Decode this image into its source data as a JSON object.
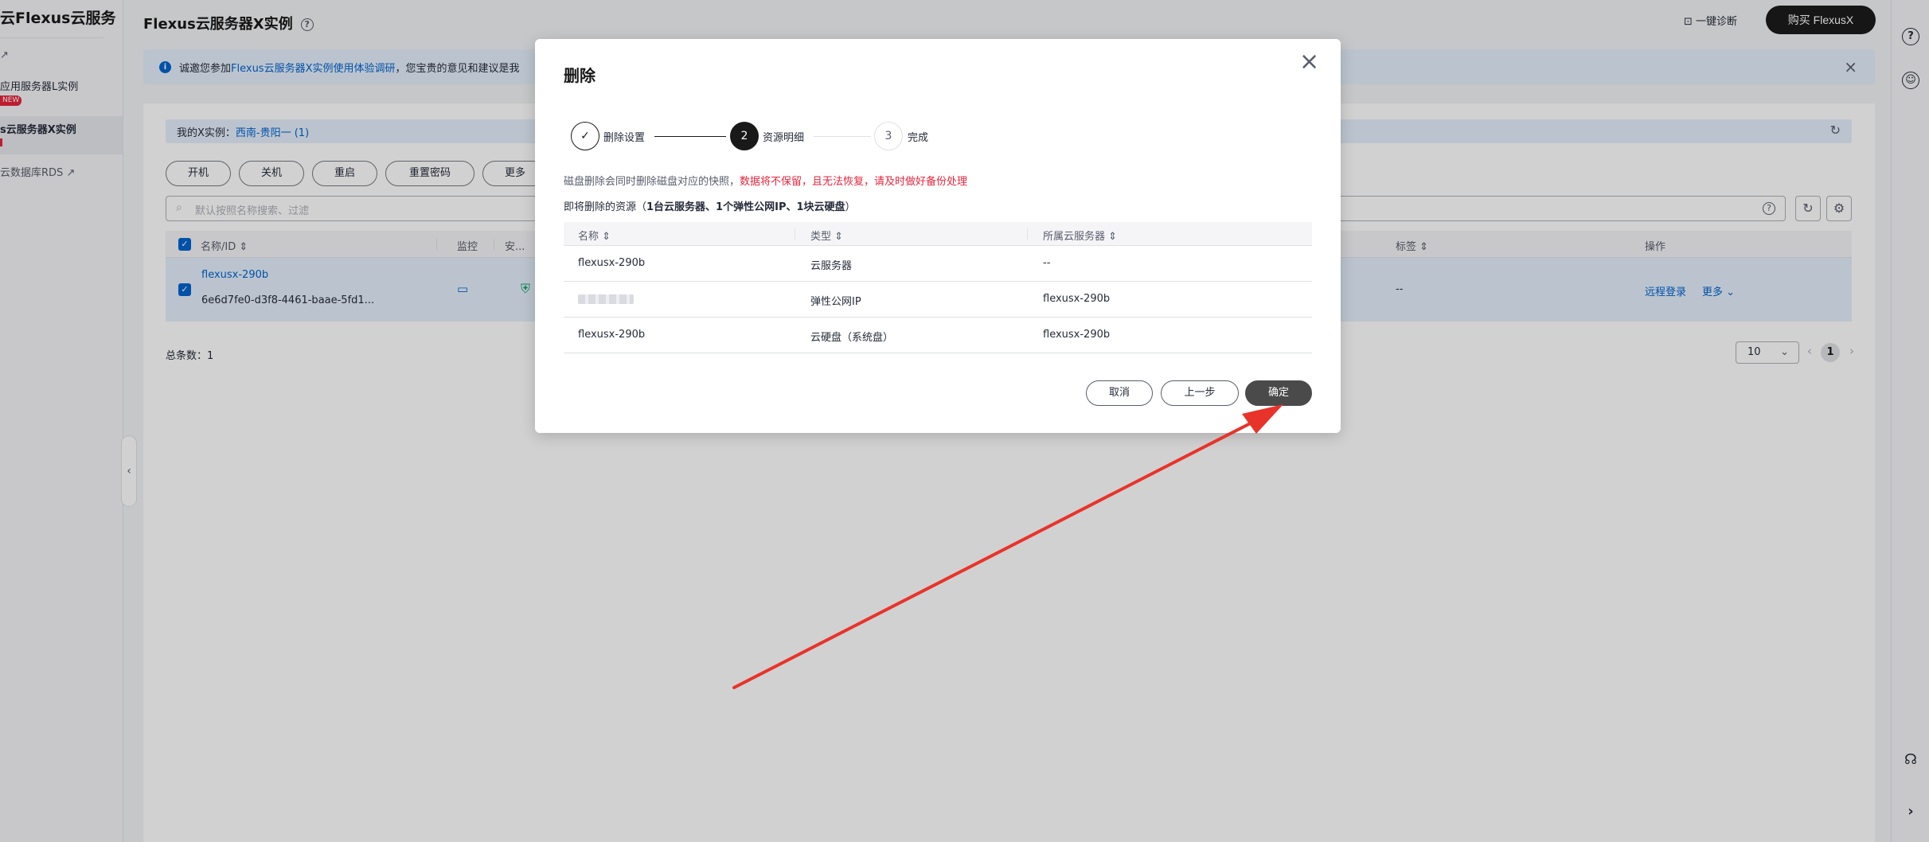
{
  "sidebar": {
    "title": "云Flexus云服务",
    "ext_icon": "↗",
    "item1": "应用服务器L实例",
    "new_badge": "NEW",
    "item2": "s云服务器X实例",
    "item3": "云数据库RDS"
  },
  "header": {
    "title": "Flexus云服务器X实例",
    "diagnose": "一键诊断",
    "buy": "购买 FlexusX"
  },
  "notice": {
    "prefix": "诚邀您参加",
    "link": "Flexus云服务器X实例使用体验调研",
    "suffix": "，您宝贵的意见和建议是我"
  },
  "region": {
    "label": "我的X实例：",
    "value": "西南-贵阳一 (1)"
  },
  "actions": [
    "开机",
    "关机",
    "重启",
    "重置密码",
    "更多"
  ],
  "search": {
    "placeholder": "默认按照名称搜索、过滤"
  },
  "table": {
    "headers": {
      "name": "名称/ID",
      "monitor": "监控",
      "security": "安...",
      "tags": "标签",
      "ops": "操作"
    },
    "row": {
      "name": "flexusx-290b",
      "id": "6e6d7fe0-d3f8-4461-baae-5fd1...",
      "tags": "--",
      "remote": "远程登录",
      "more": "更多"
    }
  },
  "footer": {
    "total": "总条数：1",
    "page_size": "10",
    "page": "1"
  },
  "modal": {
    "title": "删除",
    "steps": [
      {
        "label": "删除设置",
        "num": "✓"
      },
      {
        "label": "资源明细",
        "num": "2"
      },
      {
        "label": "完成",
        "num": "3"
      }
    ],
    "warning_prefix": "磁盘删除会同时删除磁盘对应的快照，",
    "warning_red": "数据将不保留，且无法恢复，请及时做好备份处理",
    "resource_prefix": "即将删除的资源（",
    "resource_bold": "1台云服务器、1个弹性公网IP、1块云硬盘",
    "resource_suffix": "）",
    "columns": {
      "name": "名称",
      "type": "类型",
      "server": "所属云服务器"
    },
    "rows": [
      {
        "name": "flexusx-290b",
        "type": "云服务器",
        "server": "--"
      },
      {
        "name": "",
        "type": "弹性公网IP",
        "server": "flexusx-290b"
      },
      {
        "name": "flexusx-290b",
        "type": "云硬盘（系统盘）",
        "server": "flexusx-290b"
      }
    ],
    "buttons": {
      "cancel": "取消",
      "prev": "上一步",
      "confirm": "确定"
    }
  },
  "colors": {
    "accent": "#0063cf",
    "danger": "#e6253c",
    "dark": "#191919",
    "arrow": "#e8332a"
  }
}
